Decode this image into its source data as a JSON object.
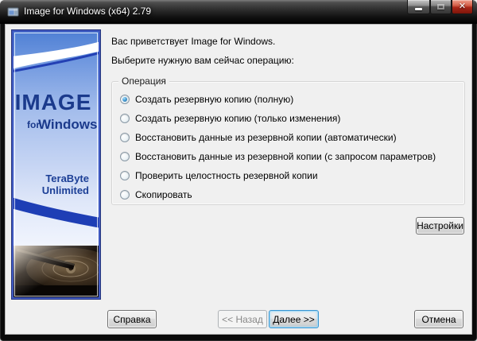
{
  "titlebar": {
    "title": "Image for Windows (x64) 2.79",
    "close_glyph": "✕"
  },
  "sidebar": {
    "brand_top": "IMAGE",
    "brand_for": "for",
    "brand_bottom": "Windows",
    "company_top": "TeraByte",
    "company_bottom": "Unlimited"
  },
  "main": {
    "greeting": "Вас приветствует Image for Windows.",
    "prompt": "Выберите нужную вам сейчас операцию:",
    "group_label": "Операция",
    "options": [
      {
        "label": "Создать резервную копию (полную)",
        "selected": true
      },
      {
        "label": "Создать резервную копию (только изменения)",
        "selected": false
      },
      {
        "label": "Восстановить данные из резервной копии (автоматически)",
        "selected": false
      },
      {
        "label": "Восстановить данные из резервной копии (с запросом параметров)",
        "selected": false
      },
      {
        "label": "Проверить целостность резервной копии",
        "selected": false
      },
      {
        "label": "Скопировать",
        "selected": false
      }
    ],
    "settings_button": "Настройки"
  },
  "footer": {
    "help_button": "Справка",
    "back_button": "<< Назад",
    "back_disabled": true,
    "next_button": "Далее >>",
    "cancel_button": "Отмена"
  },
  "colors": {
    "brand_navy": "#1b3a8c",
    "swoosh_blue": "#1e3eb5",
    "content_bg": "#f0f0f0",
    "close_red": "#a92617"
  }
}
